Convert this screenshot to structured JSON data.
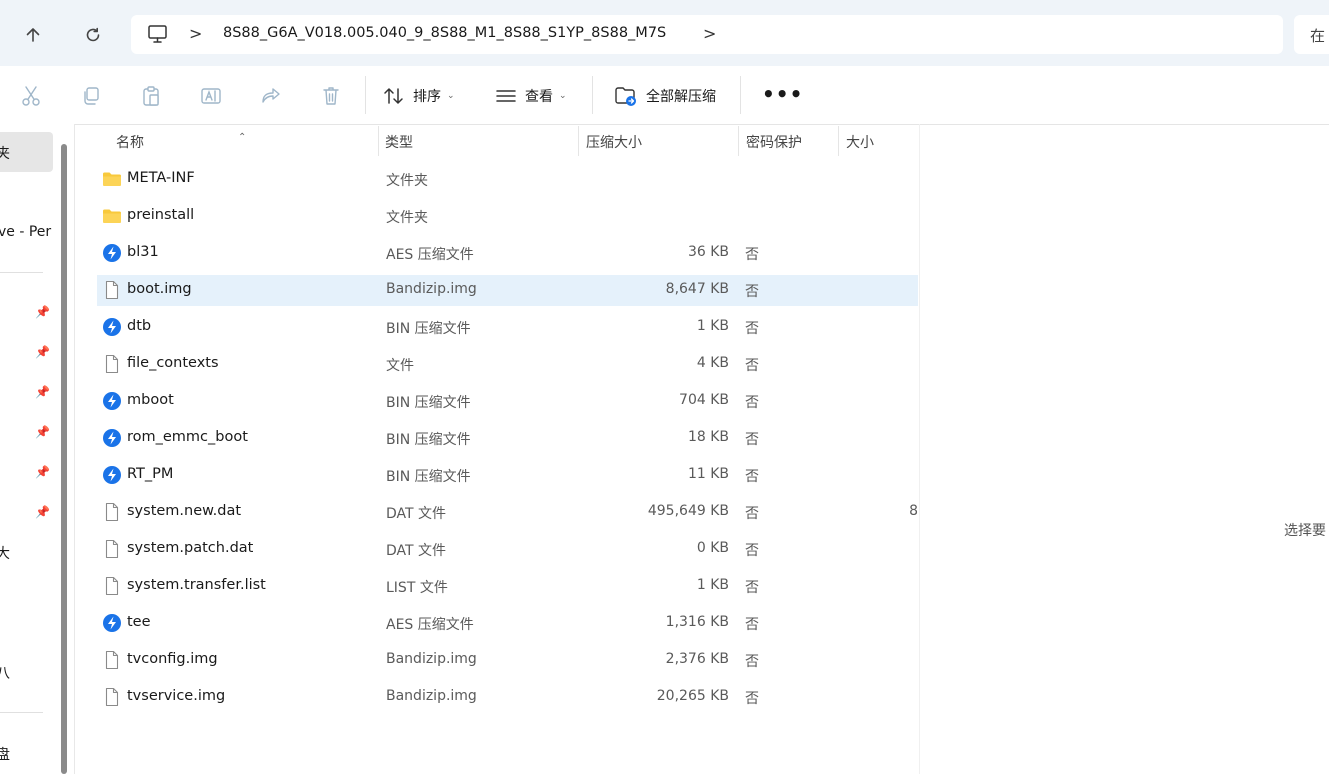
{
  "nav": {
    "back_icon": "arrow-up-icon",
    "refresh_icon": "refresh-icon"
  },
  "address": {
    "path": "8S88_G6A_V018.005.040_9_8S88_M1_8S88_S1YP_8S88_M7S",
    "separator": ">"
  },
  "search": {
    "placeholder": "在"
  },
  "toolbar": {
    "sort_label": "排序",
    "view_label": "查看",
    "extract_all_label": "全部解压缩",
    "more_label": "•••"
  },
  "sidebar": {
    "items": [
      {
        "label": "夹"
      },
      {
        "label": "ve - Per"
      },
      {
        "label": "大"
      },
      {
        "label": "八"
      },
      {
        "label": "盘"
      }
    ]
  },
  "columns": {
    "name": "名称",
    "type": "类型",
    "compressed_size": "压缩大小",
    "password": "密码保护",
    "size": "大小"
  },
  "files": [
    {
      "name": "META-INF",
      "type": "文件夹",
      "compressed": "",
      "password": "",
      "original": "",
      "icon": "folder-icon"
    },
    {
      "name": "preinstall",
      "type": "文件夹",
      "compressed": "",
      "password": "",
      "original": "",
      "icon": "folder-icon"
    },
    {
      "name": "bl31",
      "type": "AES 压缩文件",
      "compressed": "36 KB",
      "password": "否",
      "original": "",
      "icon": "bandizip-icon"
    },
    {
      "name": "boot.img",
      "type": "Bandizip.img",
      "compressed": "8,647 KB",
      "password": "否",
      "original": "",
      "icon": "file-icon",
      "selected": true
    },
    {
      "name": "dtb",
      "type": "BIN 压缩文件",
      "compressed": "1 KB",
      "password": "否",
      "original": "",
      "icon": "bandizip-icon"
    },
    {
      "name": "file_contexts",
      "type": "文件",
      "compressed": "4 KB",
      "password": "否",
      "original": "",
      "icon": "file-icon"
    },
    {
      "name": "mboot",
      "type": "BIN 压缩文件",
      "compressed": "704 KB",
      "password": "否",
      "original": "",
      "icon": "bandizip-icon"
    },
    {
      "name": "rom_emmc_boot",
      "type": "BIN 压缩文件",
      "compressed": "18 KB",
      "password": "否",
      "original": "",
      "icon": "bandizip-icon"
    },
    {
      "name": "RT_PM",
      "type": "BIN 压缩文件",
      "compressed": "11 KB",
      "password": "否",
      "original": "",
      "icon": "bandizip-icon"
    },
    {
      "name": "system.new.dat",
      "type": "DAT 文件",
      "compressed": "495,649 KB",
      "password": "否",
      "original": "8",
      "icon": "file-icon"
    },
    {
      "name": "system.patch.dat",
      "type": "DAT 文件",
      "compressed": "0 KB",
      "password": "否",
      "original": "",
      "icon": "file-icon"
    },
    {
      "name": "system.transfer.list",
      "type": "LIST 文件",
      "compressed": "1 KB",
      "password": "否",
      "original": "",
      "icon": "file-icon"
    },
    {
      "name": "tee",
      "type": "AES 压缩文件",
      "compressed": "1,316 KB",
      "password": "否",
      "original": "",
      "icon": "bandizip-icon"
    },
    {
      "name": "tvconfig.img",
      "type": "Bandizip.img",
      "compressed": "2,376 KB",
      "password": "否",
      "original": "",
      "icon": "file-icon"
    },
    {
      "name": "tvservice.img",
      "type": "Bandizip.img",
      "compressed": "20,265 KB",
      "password": "否",
      "original": "",
      "icon": "file-icon"
    }
  ],
  "details": {
    "hint": "选择要"
  },
  "colors": {
    "selection": "#e5f1fb",
    "folder": "#f8c93c",
    "bandizip": "#1a73e8",
    "address_bg": "#eff4f9"
  }
}
